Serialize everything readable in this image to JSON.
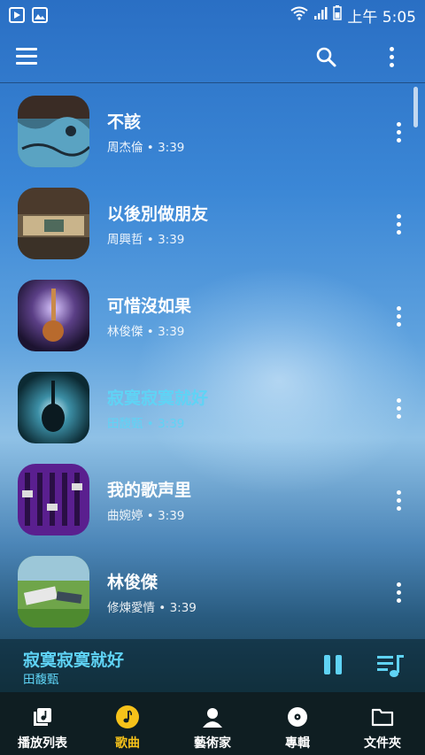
{
  "status_bar": {
    "time": "上午 5:05"
  },
  "app_bar": {
    "menu_icon": "hamburger-menu-icon",
    "search_icon": "search-icon",
    "more_icon": "more-vert-icon"
  },
  "songs": [
    {
      "title": "不該",
      "artist": "周杰倫",
      "duration": "3:39",
      "active": false
    },
    {
      "title": "以後別做朋友",
      "artist": "周興哲",
      "duration": "3:39",
      "active": false
    },
    {
      "title": "可惜沒如果",
      "artist": "林俊傑",
      "duration": "3:39",
      "active": false
    },
    {
      "title": "寂寞寂寞就好",
      "artist": "田馥甄",
      "duration": "3:39",
      "active": true
    },
    {
      "title": "我的歌声里",
      "artist": "曲婉婷",
      "duration": "3:39",
      "active": false
    },
    {
      "title": "林俊傑",
      "artist": "修煉愛情",
      "duration": "3:39",
      "active": false
    }
  ],
  "separator": "•",
  "now_playing": {
    "title": "寂寞寂寞就好",
    "artist": "田馥甄"
  },
  "bottom_nav": [
    {
      "label": "播放列表",
      "icon": "playlist-icon",
      "active": false
    },
    {
      "label": "歌曲",
      "icon": "music-note-icon",
      "active": true
    },
    {
      "label": "藝術家",
      "icon": "artist-icon",
      "active": false
    },
    {
      "label": "專輯",
      "icon": "album-icon",
      "active": false
    },
    {
      "label": "文件夾",
      "icon": "folder-icon",
      "active": false
    }
  ],
  "colors": {
    "accent": "#5fd3f5",
    "nav_active": "#f6c21a",
    "nav_bg": "#0f1e22"
  }
}
